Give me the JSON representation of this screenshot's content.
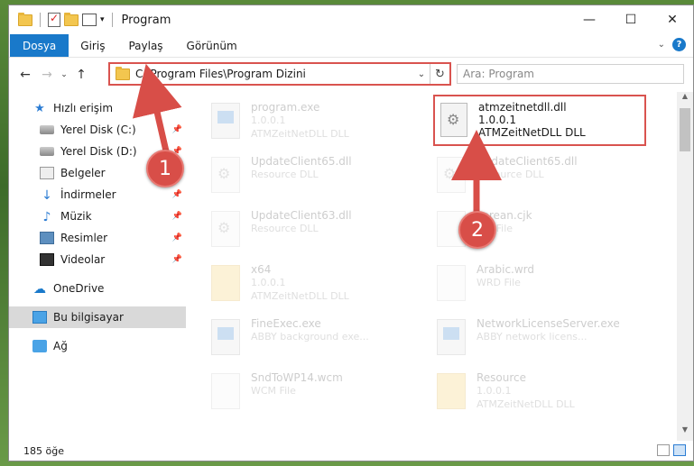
{
  "window": {
    "title": "Program"
  },
  "ribbon": {
    "tabs": [
      "Dosya",
      "Giriş",
      "Paylaş",
      "Görünüm"
    ]
  },
  "address": {
    "path": "C:\\Program Files\\Program Dizini",
    "search_placeholder": "Ara: Program"
  },
  "nav": {
    "items": [
      {
        "label": "Hızlı erişim",
        "icon": "star-icon"
      },
      {
        "label": "Yerel Disk (C:)",
        "icon": "disk-icon",
        "pinned": true
      },
      {
        "label": "Yerel Disk (D:)",
        "icon": "disk-icon",
        "pinned": true
      },
      {
        "label": "Belgeler",
        "icon": "documents-icon",
        "pinned": true
      },
      {
        "label": "İndirmeler",
        "icon": "download-icon",
        "pinned": true
      },
      {
        "label": "Müzik",
        "icon": "music-icon",
        "pinned": true
      },
      {
        "label": "Resimler",
        "icon": "pictures-icon",
        "pinned": true
      },
      {
        "label": "Videolar",
        "icon": "videos-icon",
        "pinned": true
      },
      {
        "label": "OneDrive",
        "icon": "cloud-icon"
      },
      {
        "label": "Bu bilgisayar",
        "icon": "computer-icon",
        "selected": true
      },
      {
        "label": "Ağ",
        "icon": "network-icon"
      }
    ]
  },
  "files": {
    "left": [
      {
        "name": "program.exe",
        "sub1": "1.0.0.1",
        "sub2": "ATMZeitNetDLL DLL",
        "icon": "exe-icon"
      },
      {
        "name": "UpdateClient65.dll",
        "sub1": "Resource DLL",
        "sub2": "",
        "icon": "dll-icon"
      },
      {
        "name": "UpdateClient63.dll",
        "sub1": "Resource DLL",
        "sub2": "",
        "icon": "dll-icon"
      },
      {
        "name": "x64",
        "sub1": "1.0.0.1",
        "sub2": "ATMZeitNetDLL DLL",
        "icon": "folder-icon"
      },
      {
        "name": "FineExec.exe",
        "sub1": "ABBY background exe...",
        "sub2": "",
        "icon": "exe-icon"
      },
      {
        "name": "SndToWP14.wcm",
        "sub1": "WCM File",
        "sub2": "",
        "icon": "file-icon"
      }
    ],
    "right": [
      {
        "name": "UpdateClient65.dll",
        "sub1": "Resource DLL",
        "sub2": "",
        "icon": "dll-icon"
      },
      {
        "name": "korean.cjk",
        "sub1": "CJK File",
        "sub2": "",
        "icon": "file-icon"
      },
      {
        "name": "Arabic.wrd",
        "sub1": "WRD File",
        "sub2": "",
        "icon": "file-icon"
      },
      {
        "name": "NetworkLicenseServer.exe",
        "sub1": "ABBY network licens...",
        "sub2": "",
        "icon": "exe-icon"
      },
      {
        "name": "Resource",
        "sub1": "1.0.0.1",
        "sub2": "ATMZeitNetDLL DLL",
        "icon": "folder-icon"
      }
    ],
    "highlighted": {
      "name": "atmzeitnetdll.dll",
      "sub1": "1.0.0.1",
      "sub2": "ATMZeitNetDLL DLL",
      "icon": "dll-gear-icon"
    }
  },
  "status": {
    "count": "185 öğe"
  },
  "annotations": {
    "badge1": "1",
    "badge2": "2"
  },
  "colors": {
    "accent": "#1979ca",
    "annotation": "#d84e48"
  }
}
